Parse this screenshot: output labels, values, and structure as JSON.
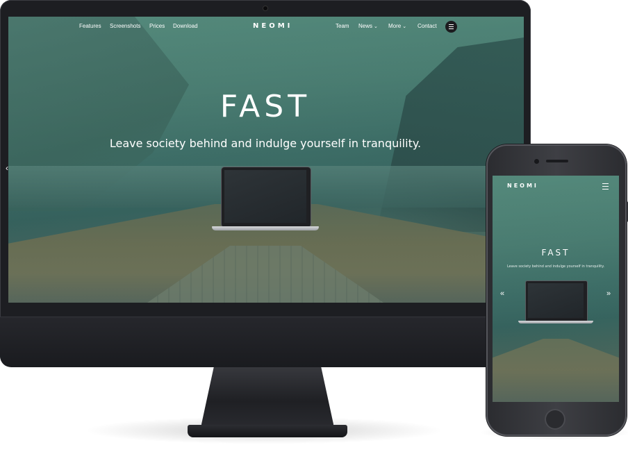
{
  "desktop": {
    "nav_left": [
      "Features",
      "Screenshots",
      "Prices",
      "Download"
    ],
    "logo": "NEOMI",
    "nav_right": {
      "team": "Team",
      "news": "News",
      "more": "More",
      "contact": "Contact"
    },
    "caret": "⌄",
    "hero_title": "FAST",
    "hero_subtitle": "Leave society behind and indulge yourself in tranquility.",
    "left_arrow": "‹"
  },
  "mobile": {
    "logo": "NEOMI",
    "hero_title": "FAST",
    "hero_subtitle": "Leave society behind and indulge yourself in tranquility.",
    "prev_arrow": "«",
    "next_arrow": "»"
  },
  "icons": {
    "menu": "hamburger-icon",
    "dropdown": "chevron-down-icon"
  },
  "colors": {
    "overlay": "#4f7d73",
    "device_dark": "#1d1e22",
    "text": "#ffffff"
  }
}
